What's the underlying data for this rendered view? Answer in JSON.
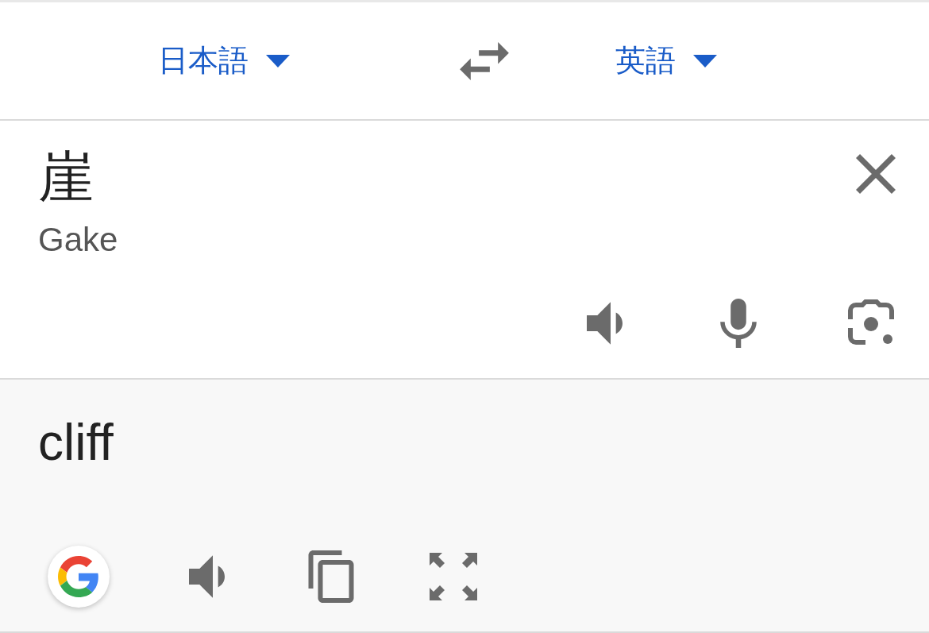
{
  "source_language": {
    "label": "日本語"
  },
  "target_language": {
    "label": "英語"
  },
  "input": {
    "text": "崖",
    "romanization": "Gake"
  },
  "output": {
    "text": "cliff"
  }
}
